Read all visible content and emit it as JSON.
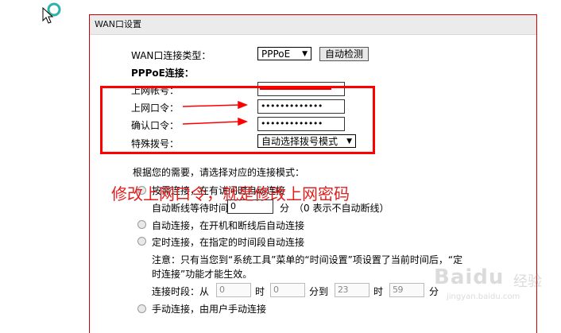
{
  "panel": {
    "title": "WAN口设置"
  },
  "wan_type": {
    "label": "WAN口连接类型：",
    "selected": "PPPoE",
    "detect_button": "自动检测"
  },
  "pppoe": {
    "section_label": "PPPoE连接：",
    "account_label": "上网帐号：",
    "password_label": "上网口令：",
    "password_mask": "•••••••••••••",
    "confirm_label": "确认口令：",
    "confirm_mask": "•••••••••••••",
    "dial_label": "特殊拨号：",
    "dial_selected": "自动选择拨号模式"
  },
  "mode": {
    "prompt": "根据您的需要，请选择对应的连接模式：",
    "on_demand_text": "按需连接，在有访问时自动连接",
    "idle_label": "自动断线等待时间：",
    "idle_value": "0",
    "idle_unit": "分",
    "idle_hint": "（0 表示不自动断线）",
    "auto_text": "自动连接，在开机和断线后自动连接",
    "timed_text": "定时连接，在指定的时间段自动连接",
    "note_line1": "注意：只有当您到“系统工具”菜单的“时间设置”项设置了当前时间后，“定",
    "note_line2": "时连接”功能才能生效。",
    "period_label": "连接时段：从",
    "from_hour": "0",
    "hour_label": "时",
    "from_min": "0",
    "to_label": "分到",
    "to_hour": "23",
    "hour_label2": "时",
    "to_min": "59",
    "min_label": "分",
    "manual_text": "手动连接，由用户手动连接"
  },
  "annotation": {
    "text": "修改上网口令，就是修改上网密码"
  },
  "watermark": {
    "brand": "Baidu",
    "sub": "经验",
    "url": "jingyan.baidu.com"
  }
}
